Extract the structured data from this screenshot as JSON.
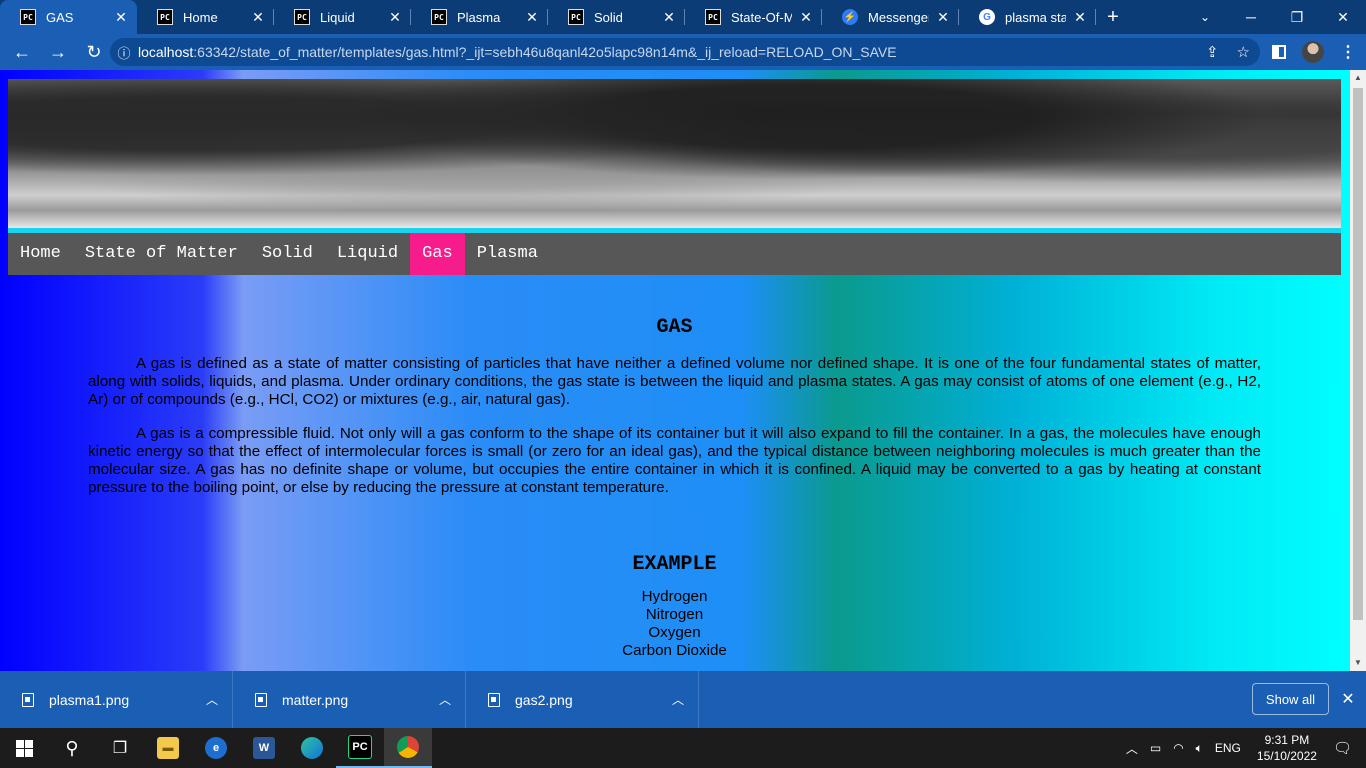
{
  "browser": {
    "tabs": [
      {
        "title": "GAS",
        "favicon": "pycharm-icon",
        "active": true
      },
      {
        "title": "Home",
        "favicon": "pycharm-icon"
      },
      {
        "title": "Liquid",
        "favicon": "pycharm-icon"
      },
      {
        "title": "Plasma",
        "favicon": "pycharm-icon"
      },
      {
        "title": "Solid",
        "favicon": "pycharm-icon"
      },
      {
        "title": "State-Of-Mat",
        "favicon": "pycharm-icon"
      },
      {
        "title": "Messenger",
        "favicon": "messenger-icon"
      },
      {
        "title": "plasma state",
        "favicon": "google-icon"
      }
    ],
    "favicon_text": "PC",
    "url_host": "localhost",
    "url_rest": ":63342/state_of_matter/templates/gas.html?_ijt=sebh46u8qanl42o5lapc98n14m&_ij_reload=RELOAD_ON_SAVE"
  },
  "page": {
    "nav": [
      {
        "label": "Home"
      },
      {
        "label": "State of Matter"
      },
      {
        "label": "Solid"
      },
      {
        "label": "Liquid"
      },
      {
        "label": "Gas",
        "active": true
      },
      {
        "label": "Plasma"
      }
    ],
    "title": "GAS",
    "paragraph1": "A gas is defined as a state of matter consisting of particles that have neither a defined volume nor defined shape. It is one of the four fundamental states of matter, along with solids, liquids, and plasma. Under ordinary conditions, the gas state is between the liquid and plasma states. A gas may consist of atoms of one element (e.g., H2, Ar) or of compounds (e.g., HCl, CO2) or mixtures (e.g., air, natural gas).",
    "paragraph2": "A gas is a compressible fluid. Not only will a gas conform to the shape of its container but it will also expand to fill the container. In a gas, the molecules have enough kinetic energy so that the effect of intermolecular forces is small (or zero for an ideal gas), and the typical distance between neighboring molecules is much greater than the molecular size. A gas has no definite shape or volume, but occupies the entire container in which it is confined. A liquid may be converted to a gas by heating at constant pressure to the boiling point, or else by reducing the pressure at constant temperature.",
    "example_heading": "EXAMPLE",
    "examples": [
      "Hydrogen",
      "Nitrogen",
      "Oxygen",
      "Carbon Dioxide"
    ]
  },
  "downloads": {
    "items": [
      {
        "name": "plasma1.png"
      },
      {
        "name": "matter.png"
      },
      {
        "name": "gas2.png"
      }
    ],
    "show_all": "Show all"
  },
  "taskbar": {
    "language": "ENG",
    "time": "9:31 PM",
    "date": "15/10/2022"
  },
  "colors": {
    "nav_active": "#f61c8c",
    "nav_background": "#575757",
    "browser_frame": "#1a5fb4"
  }
}
